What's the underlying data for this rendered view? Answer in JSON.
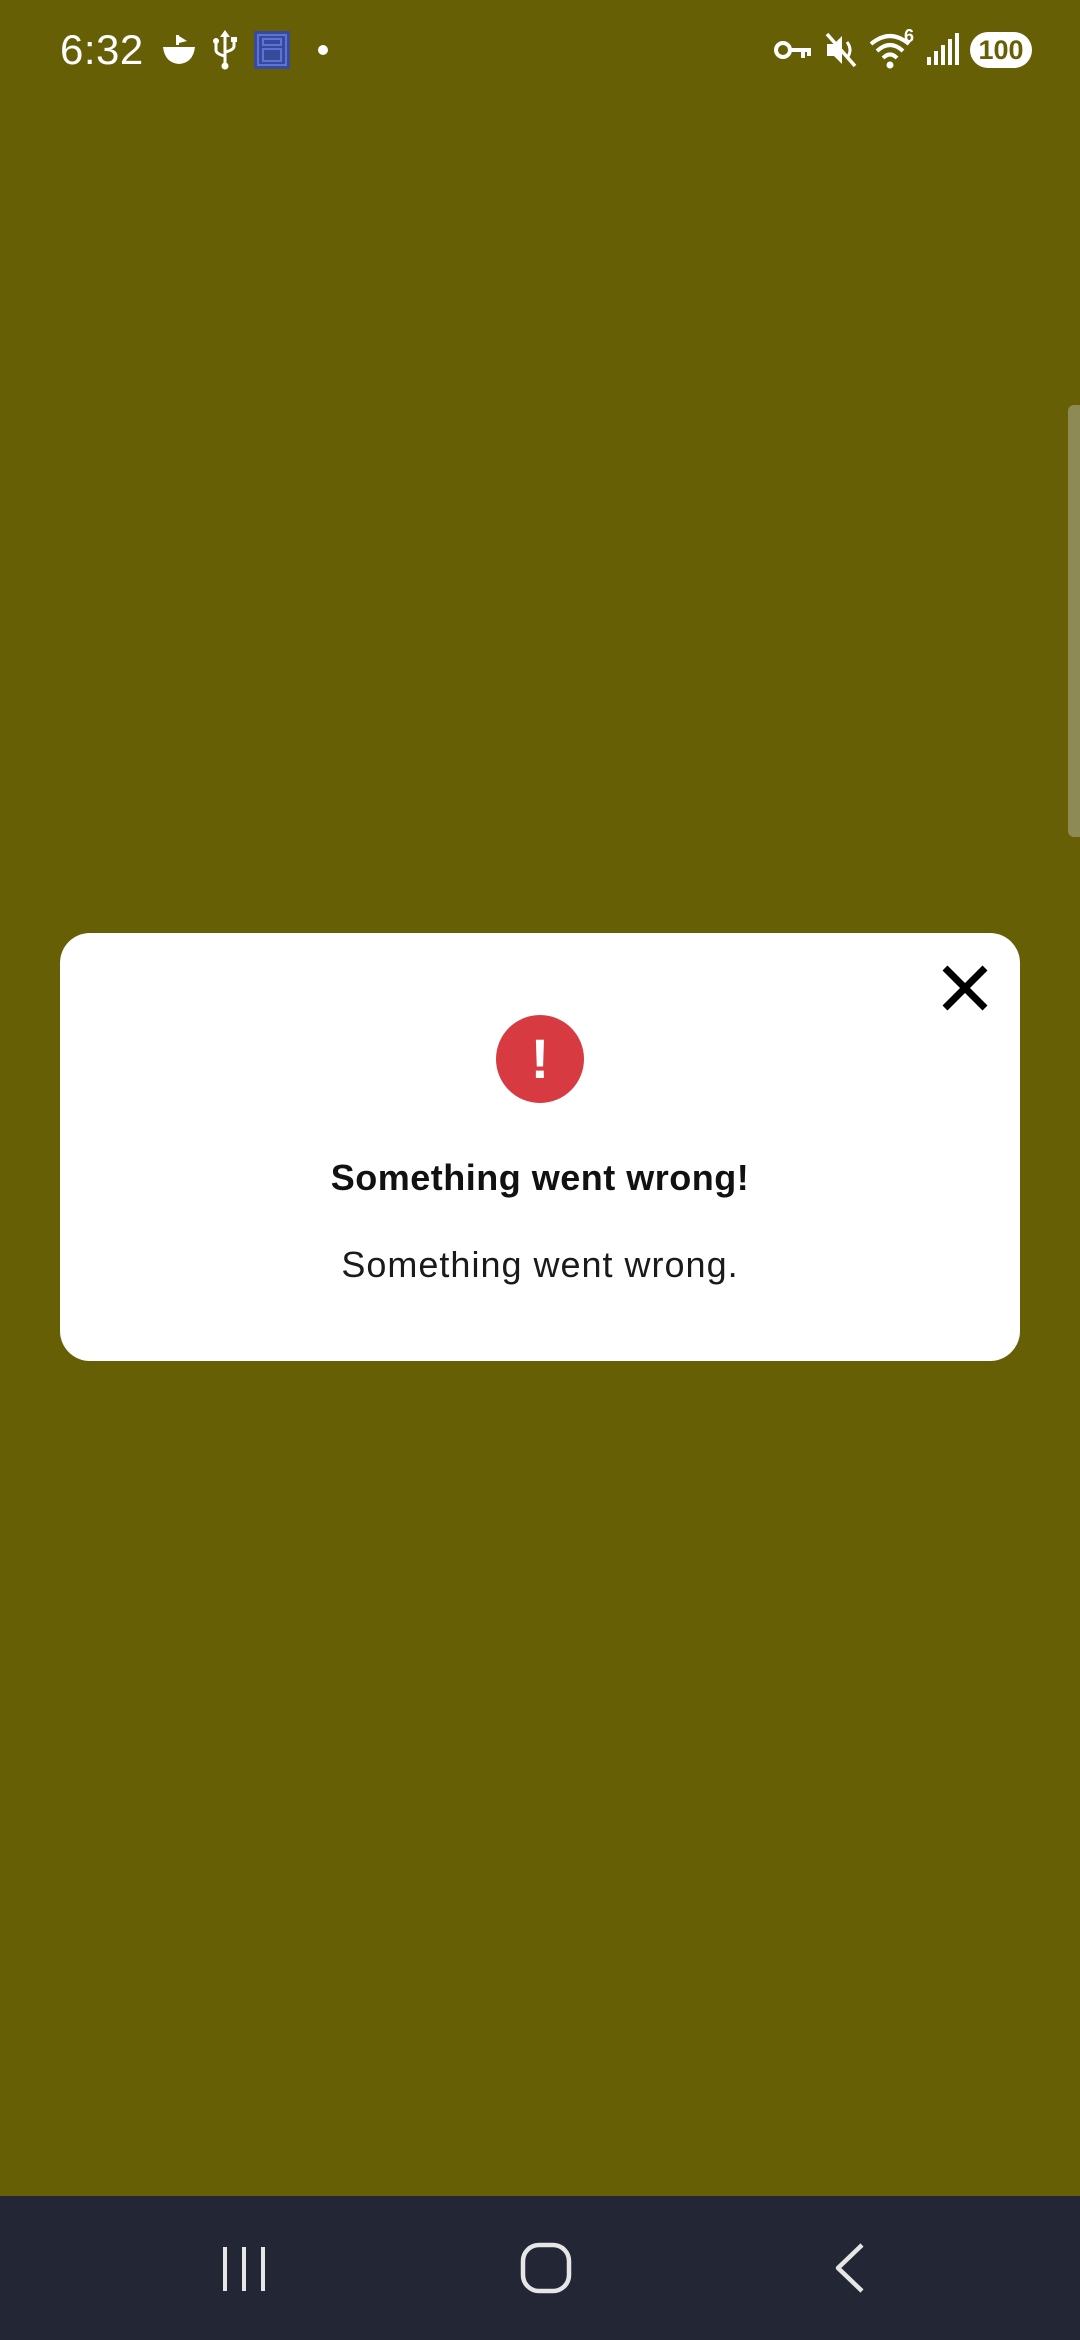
{
  "status_bar": {
    "time": "6:32",
    "left_icons": [
      "ship-icon",
      "usb-icon",
      "app-notification-icon",
      "dot-icon"
    ],
    "right_icons": [
      "vpn-key-icon",
      "mute-icon",
      "wifi-icon",
      "signal-icon"
    ],
    "wifi_label": "6",
    "battery": "100"
  },
  "dialog": {
    "icon": "error-exclamation-icon",
    "icon_mark": "!",
    "title": "Something went wrong!",
    "message": "Something went wrong.",
    "close_icon": "close-icon"
  },
  "navigation": {
    "buttons": [
      "recent-apps-icon",
      "home-icon",
      "back-icon"
    ]
  },
  "colors": {
    "background": "#675f06",
    "dialog_background": "#ffffff",
    "error_red": "#d73a40",
    "nav_bar": "#222635"
  }
}
